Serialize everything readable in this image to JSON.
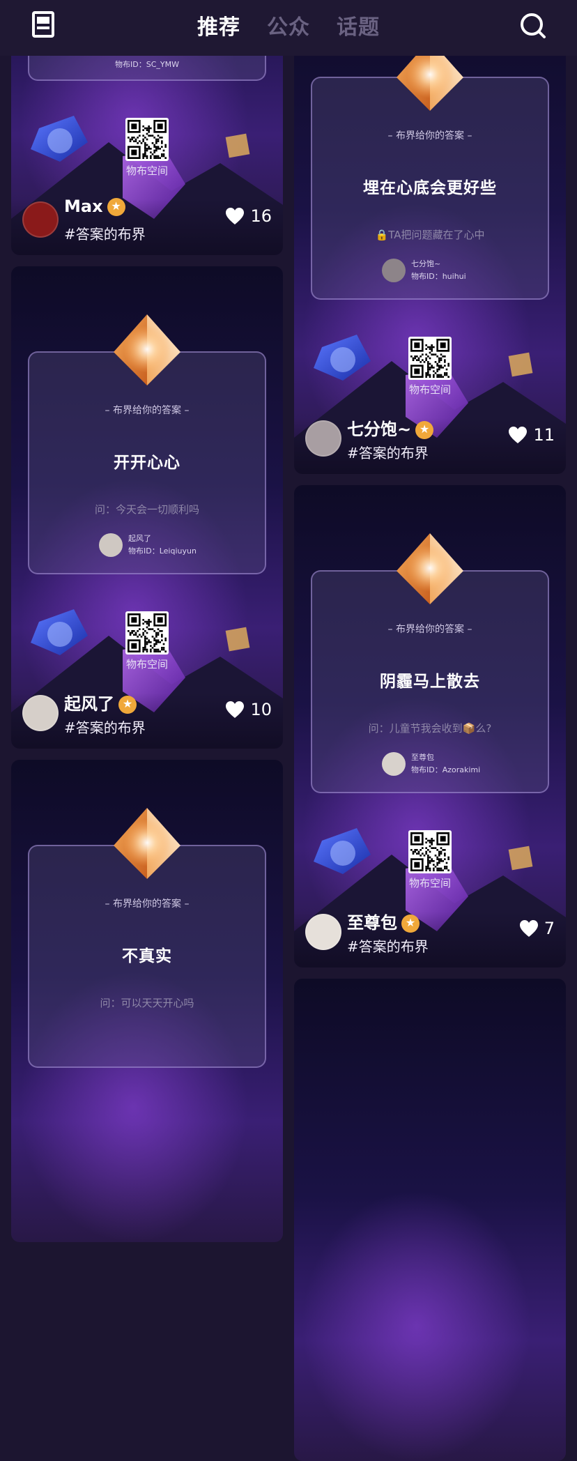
{
  "header": {
    "tabs": [
      "推荐",
      "公众",
      "话题"
    ],
    "active_tab": 0
  },
  "left_column": [
    {
      "top_user_id": "物布ID：SC_YMW",
      "qr_label": "物布空间",
      "author": "Max",
      "topic": "#答案的布界",
      "likes": "16"
    },
    {
      "caption": "– 布界给你的答案 –",
      "answer": "开开心心",
      "question": "问：今天会一切顺利吗",
      "user_name": "起风了",
      "user_id": "物布ID：Leiqiuyun",
      "qr_label": "物布空间",
      "author": "起风了",
      "topic": "#答案的布界",
      "likes": "10"
    },
    {
      "caption": "– 布界给你的答案 –",
      "answer": "不真实",
      "question": "问：可以天天开心吗"
    }
  ],
  "right_column": [
    {
      "caption": "– 布界给你的答案 –",
      "answer": "埋在心底会更好些",
      "question": "🔒TA把问题藏在了心中",
      "user_name": "七分饱~",
      "user_id": "物布ID：huihui",
      "qr_label": "物布空间",
      "author": "七分饱~",
      "topic": "#答案的布界",
      "likes": "11"
    },
    {
      "caption": "– 布界给你的答案 –",
      "answer": "阴霾马上散去",
      "question": "问：儿童节我会收到📦么?",
      "user_name": "至尊包",
      "user_id": "物布ID：Azorakimi",
      "qr_label": "物布空间",
      "author": "至尊包",
      "topic": "#答案的布界",
      "likes": "7"
    }
  ],
  "colors": {
    "background": "#1c1530",
    "header": "#1f1833",
    "tab_inactive": "#6a6282",
    "badge": "#f0a83a",
    "gem": "#e8893a"
  },
  "icons": [
    "menu-icon",
    "search-icon",
    "heart-icon",
    "verified-badge-icon",
    "gem-icon",
    "lock-icon"
  ]
}
